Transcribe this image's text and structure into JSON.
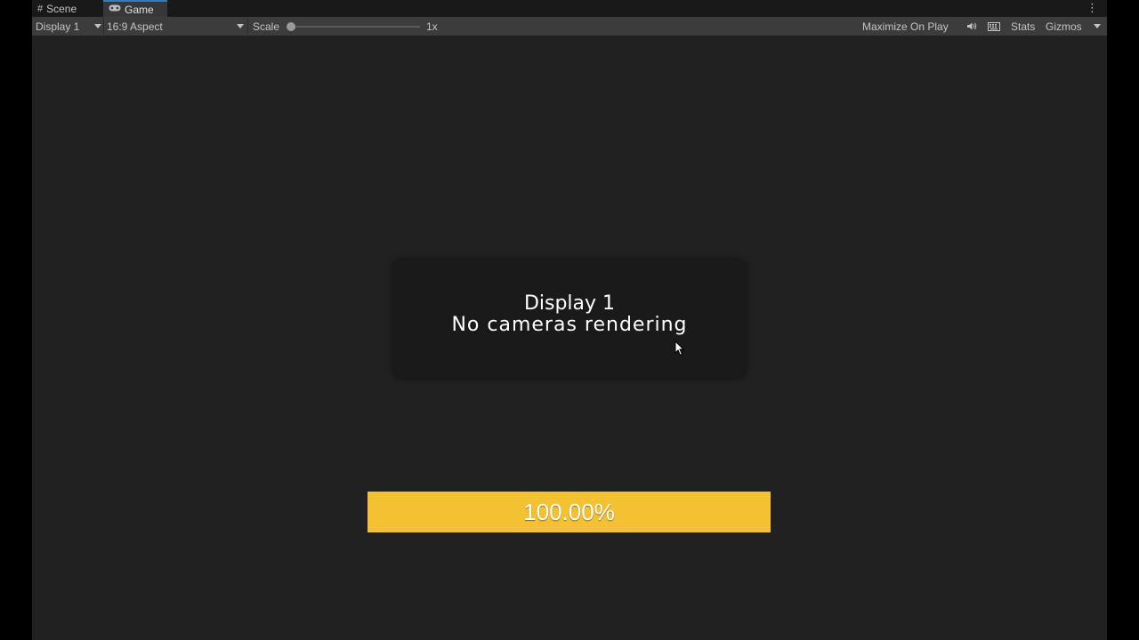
{
  "tabs": [
    {
      "label": "Scene",
      "icon": "grid-icon",
      "active": false
    },
    {
      "label": "Game",
      "icon": "gamepad-icon",
      "active": true
    }
  ],
  "toolbar": {
    "display_select": "Display 1",
    "aspect_select": "16:9 Aspect",
    "scale_label": "Scale",
    "scale_value": "1x",
    "scale_fraction": 0,
    "maximize_label": "Maximize On Play",
    "stats_label": "Stats",
    "gizmos_label": "Gizmos"
  },
  "game_view": {
    "notice_line1": "Display 1",
    "notice_line2": "No cameras rendering",
    "progress_text": "100.00%",
    "progress_value": 1.0
  },
  "colors": {
    "accent": "#3a79bb",
    "progress_fill": "#f3c131",
    "background": "#212121"
  }
}
